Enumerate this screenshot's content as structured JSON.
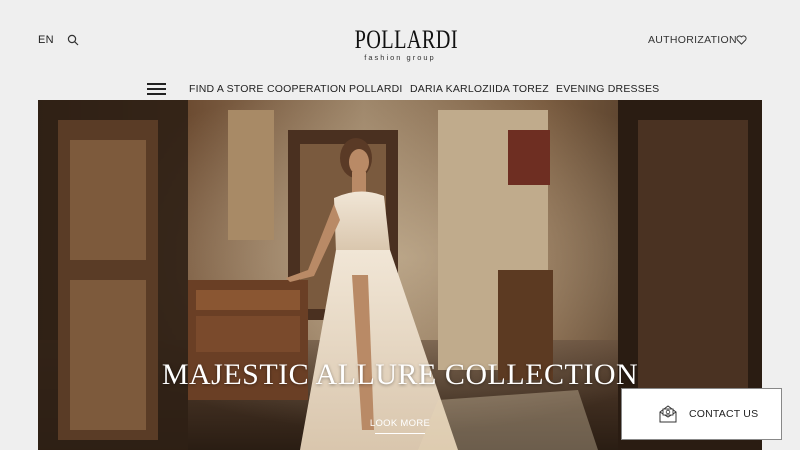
{
  "header": {
    "language": "EN",
    "logo_main": "POLLARDI",
    "logo_sub": "fashion group",
    "authorization": "AUTHORIZATION"
  },
  "nav": {
    "items": [
      "FIND A STORE",
      "COOPERATION",
      "POLLARDI",
      "DARIA KARLOZI",
      "IDA TOREZ",
      "EVENING DRESSES"
    ]
  },
  "hero": {
    "title": "MAJESTIC ALLURE COLLECTION",
    "cta": "LOOK MORE"
  },
  "contact": {
    "label": "CONTACT US"
  },
  "icons": {
    "search": "search-icon",
    "heart": "heart-icon",
    "menu": "hamburger-icon",
    "contact": "envelope-icon"
  }
}
